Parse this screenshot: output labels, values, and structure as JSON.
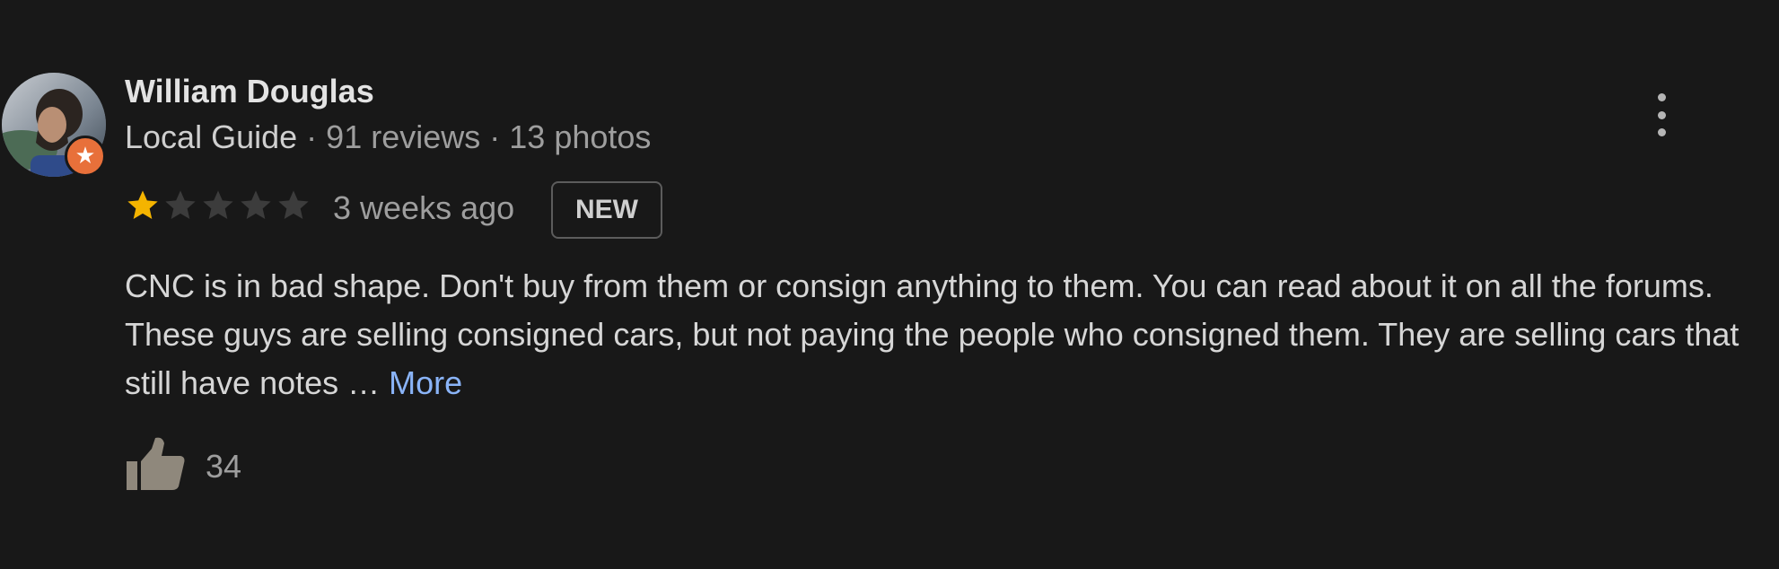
{
  "reviewer": {
    "name": "William Douglas",
    "badge_icon": "local-guide-star-icon",
    "guide_label": "Local Guide",
    "separator": "·",
    "reviews": "91 reviews",
    "photos": "13 photos"
  },
  "rating": {
    "value": 1,
    "max": 5,
    "filled_color": "#f4b400",
    "empty_color": "#3c3c3c"
  },
  "review": {
    "time": "3 weeks ago",
    "badge": "NEW",
    "text": "CNC is in bad shape. Don't buy from them or consign anything to them. You can read about it on all the forums. These guys are selling consigned cars, but not paying the people who consigned them. They are selling cars that still have notes … ",
    "more_label": "More",
    "likes": "34"
  },
  "colors": {
    "background": "#181818",
    "link": "#8ab4f8",
    "guide_badge": "#e8703a"
  },
  "icons": {
    "menu": "more-vertical-icon",
    "like": "thumbs-up-icon"
  }
}
